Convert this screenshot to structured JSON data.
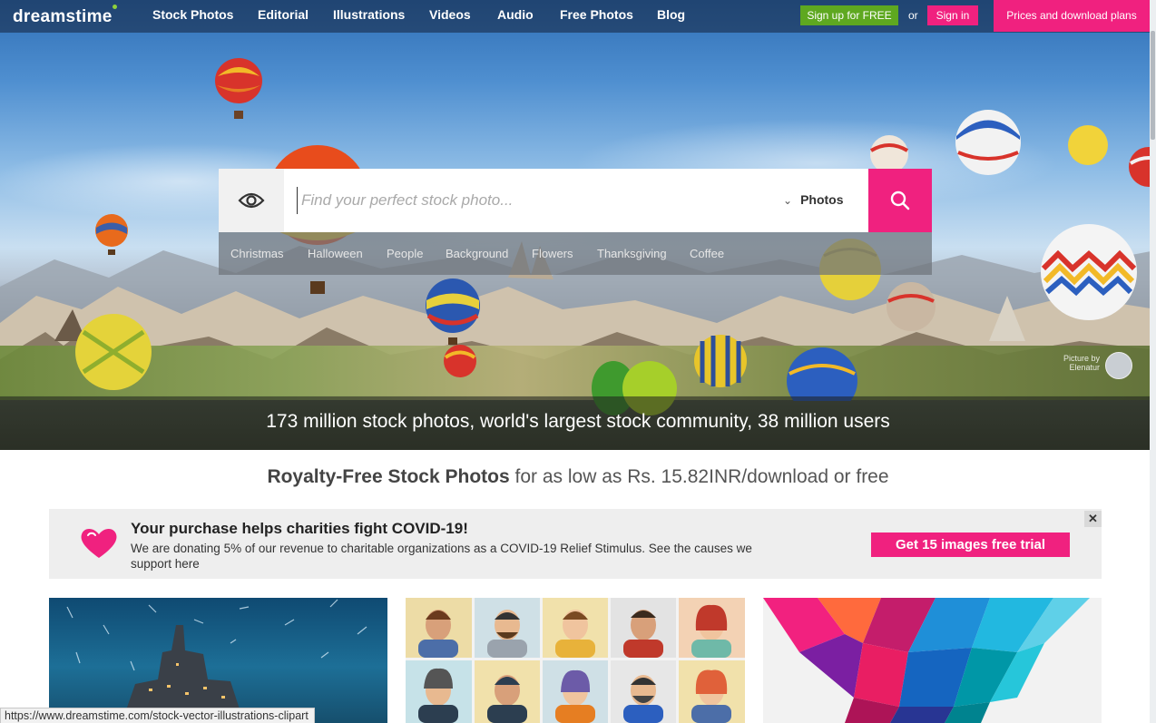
{
  "logo": {
    "text": "dreamstime"
  },
  "nav": {
    "items": [
      {
        "label": "Stock Photos"
      },
      {
        "label": "Editorial"
      },
      {
        "label": "Illustrations"
      },
      {
        "label": "Videos"
      },
      {
        "label": "Audio"
      },
      {
        "label": "Free Photos"
      },
      {
        "label": "Blog"
      }
    ],
    "signup_label": "Sign up for FREE",
    "or_label": "or",
    "signin_label": "Sign in",
    "plans_label": "Prices and download plans"
  },
  "search": {
    "placeholder": "Find your perfect stock photo...",
    "value": "",
    "type_selected": "Photos",
    "suggestions": [
      {
        "label": "Christmas"
      },
      {
        "label": "Halloween"
      },
      {
        "label": "People"
      },
      {
        "label": "Background"
      },
      {
        "label": "Flowers"
      },
      {
        "label": "Thanksgiving"
      },
      {
        "label": "Coffee"
      }
    ]
  },
  "hero": {
    "credit_line1": "Picture by",
    "credit_line2": "Elenatur",
    "tagline": "173 million stock photos, world's largest stock community, 38 million users"
  },
  "subhead": {
    "bold": "Royalty-Free Stock Photos",
    "rest": " for as low as Rs. 15.82INR/download or free"
  },
  "covid_banner": {
    "title": "Your purchase helps charities fight COVID-19!",
    "text": "We are donating 5% of our revenue to charitable organizations as a COVID-19 Relief Stimulus. See the causes we support here",
    "button_label": "Get 15 images free trial",
    "close_label": "✕"
  },
  "status_bar": {
    "url": "https://www.dreamstime.com/stock-vector-illustrations-clipart"
  },
  "colors": {
    "accent_pink": "#f0217f",
    "signup_green": "#5ea820"
  }
}
